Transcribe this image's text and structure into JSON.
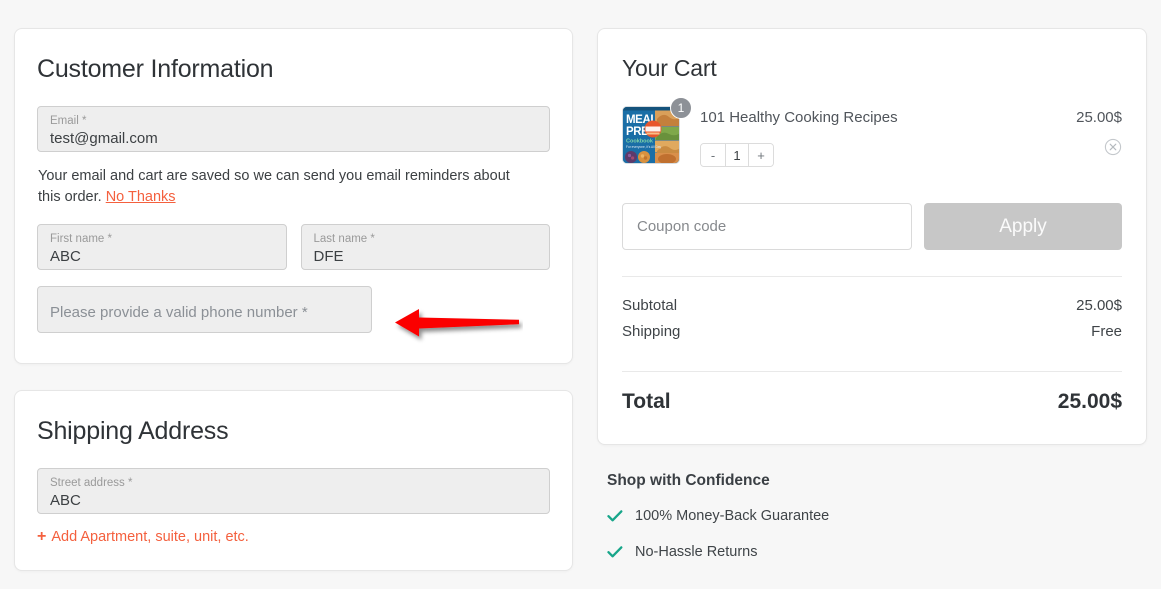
{
  "customer": {
    "title": "Customer Information",
    "email": {
      "label": "Email *",
      "value": "test@gmail.com"
    },
    "helper_prefix": "Your email and cart are saved so we can send you email reminders about this order.",
    "helper_link": "No Thanks",
    "first_name": {
      "label": "First name *",
      "value": "ABC"
    },
    "last_name": {
      "label": "Last name *",
      "value": "DFE"
    },
    "phone": {
      "placeholder": "Please provide a valid phone number *",
      "value": ""
    }
  },
  "shipping": {
    "title": "Shipping Address",
    "street": {
      "label": "Street address *",
      "value": "ABC"
    },
    "add_line_plus": "+",
    "add_line_label": "Add Apartment, suite, unit, etc."
  },
  "cart": {
    "title": "Your Cart",
    "item": {
      "name": "101 Healthy Cooking Recipes",
      "price": "25.00$",
      "quantity": "1",
      "badge": "1",
      "decrement_label": "-",
      "increment_label": "+",
      "thumbnail_line1": "MEAL",
      "thumbnail_line2": "PREP",
      "thumbnail_line3": "Cookbook",
      "thumbnail_line4": "For everyone, it's All Day"
    },
    "coupon": {
      "placeholder": "Coupon code",
      "value": ""
    },
    "apply_label": "Apply",
    "subtotal_label": "Subtotal",
    "subtotal_value": "25.00$",
    "shipping_label": "Shipping",
    "shipping_value": "Free",
    "total_label": "Total",
    "total_value": "25.00$"
  },
  "confidence": {
    "title": "Shop with Confidence",
    "items": [
      {
        "label": "100% Money-Back Guarantee"
      },
      {
        "label": "No-Hassle Returns"
      }
    ]
  },
  "colors": {
    "accent_orange": "#f4603e",
    "check_green": "#18a68a",
    "arrow_red": "#fb0000",
    "page_bg": "#f7f7f7",
    "field_bg": "#eeeeee",
    "apply_disabled": "#c7c7c7"
  },
  "annotation": {
    "arrow": "left-pointing-red-arrow"
  }
}
